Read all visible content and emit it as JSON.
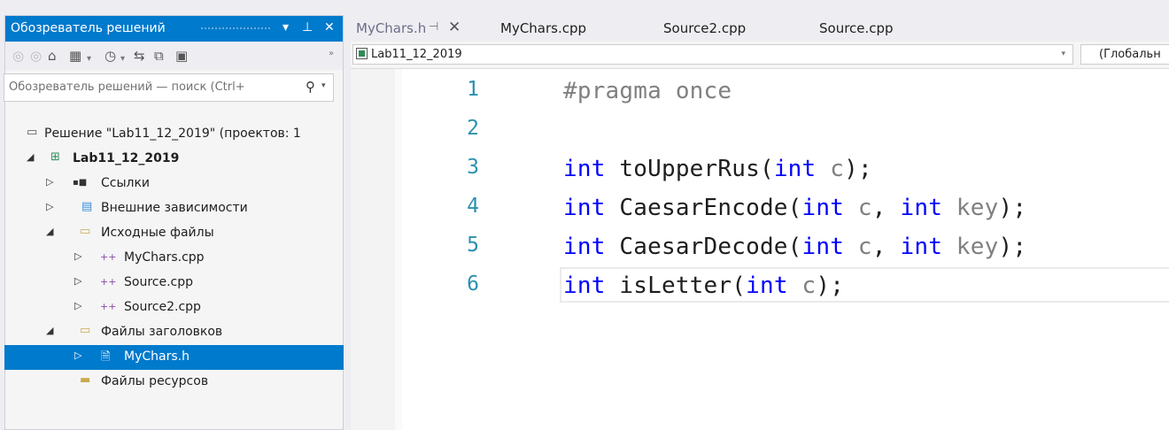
{
  "solution_explorer": {
    "title": "Обозреватель решений",
    "pin_glyph": "▾  ⊣  ✕",
    "toolbar_icons": [
      "back-icon",
      "forward-icon",
      "home-icon",
      "sync-icon",
      "history-icon",
      "collapse-icon",
      "copy-icon",
      "properties-icon"
    ],
    "search_placeholder": "Обозреватель решений — поиск (Ctrl+",
    "tree": [
      {
        "label": "Решение \"Lab11_12_2019\" (проектов: 1",
        "level": 0,
        "icon": "solution-icon",
        "arrow": ""
      },
      {
        "label": "Lab11_12_2019",
        "level": 0,
        "icon": "project-icon",
        "arrow": "◢",
        "bold": true
      },
      {
        "label": "Ссылки",
        "level": 1,
        "icon": "references-icon",
        "arrow": "▷"
      },
      {
        "label": "Внешние зависимости",
        "level": 1,
        "icon": "external-deps-icon",
        "arrow": "▷"
      },
      {
        "label": "Исходные файлы",
        "level": 1,
        "icon": "folder-icon",
        "arrow": "◢"
      },
      {
        "label": "MyChars.cpp",
        "level": 2,
        "icon": "cpp-file-icon",
        "arrow": "▷"
      },
      {
        "label": "Source.cpp",
        "level": 2,
        "icon": "cpp-file-icon",
        "arrow": "▷"
      },
      {
        "label": "Source2.cpp",
        "level": 2,
        "icon": "cpp-file-icon",
        "arrow": "▷"
      },
      {
        "label": "Файлы заголовков",
        "level": 1,
        "icon": "folder-icon",
        "arrow": "◢"
      },
      {
        "label": "MyChars.h",
        "level": 2,
        "icon": "header-file-icon",
        "arrow": "▷",
        "selected": true
      },
      {
        "label": "Файлы ресурсов",
        "level": 1,
        "icon": "folder-icon",
        "arrow": ""
      }
    ]
  },
  "editor": {
    "tabs": [
      {
        "label": "MyChars.h",
        "active": true
      },
      {
        "label": "MyChars.cpp"
      },
      {
        "label": "Source2.cpp"
      },
      {
        "label": "Source.cpp"
      }
    ],
    "project_dropdown": "Lab11_12_2019",
    "scope_dropdown": "(Глобальн",
    "lines": [
      {
        "n": "1",
        "tokens": [
          {
            "t": "#pragma once",
            "c": "pp"
          }
        ]
      },
      {
        "n": "2",
        "tokens": []
      },
      {
        "n": "3",
        "tokens": [
          {
            "t": "int",
            "c": "kw"
          },
          {
            "t": " toUpperRus(",
            "c": ""
          },
          {
            "t": "int",
            "c": "kw"
          },
          {
            "t": " c",
            "c": "pm"
          },
          {
            "t": ");",
            "c": ""
          }
        ]
      },
      {
        "n": "4",
        "tokens": [
          {
            "t": "int",
            "c": "kw"
          },
          {
            "t": " CaesarEncode(",
            "c": ""
          },
          {
            "t": "int",
            "c": "kw"
          },
          {
            "t": " c",
            "c": "pm"
          },
          {
            "t": ", ",
            "c": ""
          },
          {
            "t": "int",
            "c": "kw"
          },
          {
            "t": " key",
            "c": "pm"
          },
          {
            "t": ");",
            "c": ""
          }
        ]
      },
      {
        "n": "5",
        "tokens": [
          {
            "t": "int",
            "c": "kw"
          },
          {
            "t": " CaesarDecode(",
            "c": ""
          },
          {
            "t": "int",
            "c": "kw"
          },
          {
            "t": " c",
            "c": "pm"
          },
          {
            "t": ", ",
            "c": ""
          },
          {
            "t": "int",
            "c": "kw"
          },
          {
            "t": " key",
            "c": "pm"
          },
          {
            "t": ");",
            "c": ""
          }
        ]
      },
      {
        "n": "6",
        "tokens": [
          {
            "t": "int",
            "c": "kw"
          },
          {
            "t": " isLetter(",
            "c": ""
          },
          {
            "t": "int",
            "c": "kw"
          },
          {
            "t": " c",
            "c": "pm"
          },
          {
            "t": ");",
            "c": ""
          }
        ],
        "current": true
      }
    ]
  },
  "colors": {
    "accent": "#007acc",
    "keyword": "#0000ff",
    "line_number": "#2b91af",
    "param": "#808080"
  }
}
